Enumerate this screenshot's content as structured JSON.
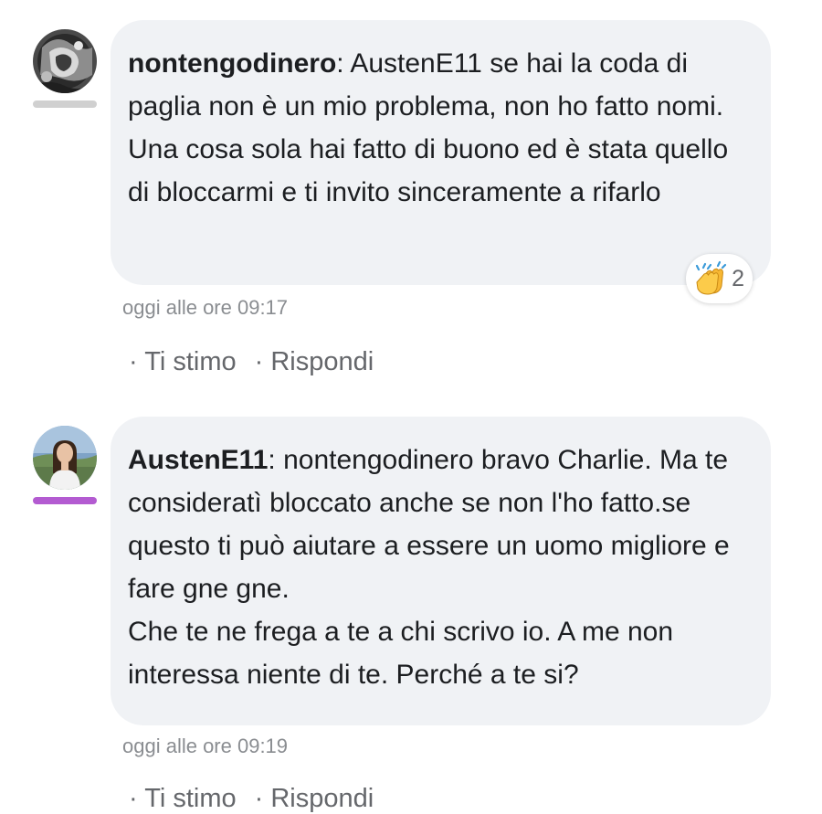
{
  "comments": [
    {
      "author": "nontengodinero",
      "separator": ": ",
      "text": "AustenE11 se hai la coda di paglia non è un mio problema, non ho fatto nomi. Una cosa sola hai fatto di buono ed è stata quello di bloccarmi e ti invito sinceramente a rifarlo",
      "timestamp": "oggi alle ore 09:17",
      "reaction": {
        "icon": "clapping-hands-icon",
        "count": "2"
      },
      "actions": {
        "like": "· Ti stimo",
        "reply": "· Rispondi"
      },
      "avatar_bar_color": "#d0d0d0"
    },
    {
      "author": "AustenE11",
      "separator": ": ",
      "text": "nontengodinero bravo Charlie. Ma te consideratì bloccato anche se non l'ho fatto.se questo ti può aiutare a essere un uomo migliore e fare gne gne.\nChe te ne frega a te a chi scrivo io. A me non interessa niente di te. Perché a te si?",
      "timestamp": "oggi alle ore 09:19",
      "actions": {
        "like": "· Ti stimo",
        "reply": "· Rispondi"
      },
      "avatar_bar_color": "#b35bd1"
    }
  ]
}
